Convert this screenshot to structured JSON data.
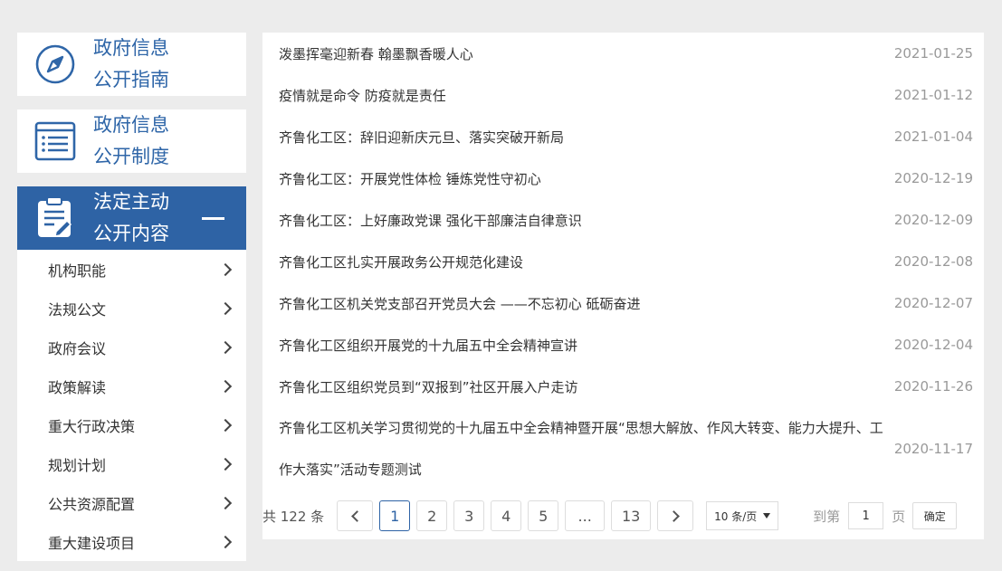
{
  "sidebar": {
    "cards": [
      {
        "line1": "政府信息",
        "line2": "公开指南",
        "icon": "compass-icon"
      },
      {
        "line1": "政府信息",
        "line2": "公开制度",
        "icon": "list-document-icon"
      },
      {
        "line1": "法定主动",
        "line2": "公开内容",
        "icon": "clipboard-edit-icon"
      }
    ],
    "items": [
      {
        "label": "机构职能"
      },
      {
        "label": "法规公文"
      },
      {
        "label": "政府会议"
      },
      {
        "label": "政策解读"
      },
      {
        "label": "重大行政决策"
      },
      {
        "label": "规划计划"
      },
      {
        "label": "公共资源配置"
      },
      {
        "label": "重大建设项目"
      }
    ]
  },
  "articles": [
    {
      "title": "泼墨挥毫迎新春 翰墨飘香暖人心",
      "date": "2021-01-25"
    },
    {
      "title": "疫情就是命令 防疫就是责任",
      "date": "2021-01-12"
    },
    {
      "title": "齐鲁化工区：辞旧迎新庆元旦、落实突破开新局",
      "date": "2021-01-04"
    },
    {
      "title": "齐鲁化工区：开展党性体检 锤炼党性守初心",
      "date": "2020-12-19"
    },
    {
      "title": "齐鲁化工区：上好廉政党课 强化干部廉洁自律意识",
      "date": "2020-12-09"
    },
    {
      "title": "齐鲁化工区扎实开展政务公开规范化建设",
      "date": "2020-12-08"
    },
    {
      "title": "齐鲁化工区机关党支部召开党员大会 ——不忘初心 砥砺奋进",
      "date": "2020-12-07"
    },
    {
      "title": "齐鲁化工区组织开展党的十九届五中全会精神宣讲",
      "date": "2020-12-04"
    },
    {
      "title": "齐鲁化工区组织党员到“双报到”社区开展入户走访",
      "date": "2020-11-26"
    },
    {
      "title": "齐鲁化工区机关学习贯彻党的十九届五中全会精神暨开展“思想大解放、作风大转变、能力大提升、工作大落实”活动专题测试",
      "date": "2020-11-17"
    }
  ],
  "pager": {
    "total": "共 122 条",
    "pages": [
      "1",
      "2",
      "3",
      "4",
      "5",
      "...",
      "13"
    ],
    "current": "1",
    "page_size": "10 条/页",
    "goto_label": "到第",
    "goto_value": "1",
    "page_label": "页",
    "confirm": "确定"
  },
  "colors": {
    "primary": "#2e63a5",
    "background": "#ececec"
  }
}
